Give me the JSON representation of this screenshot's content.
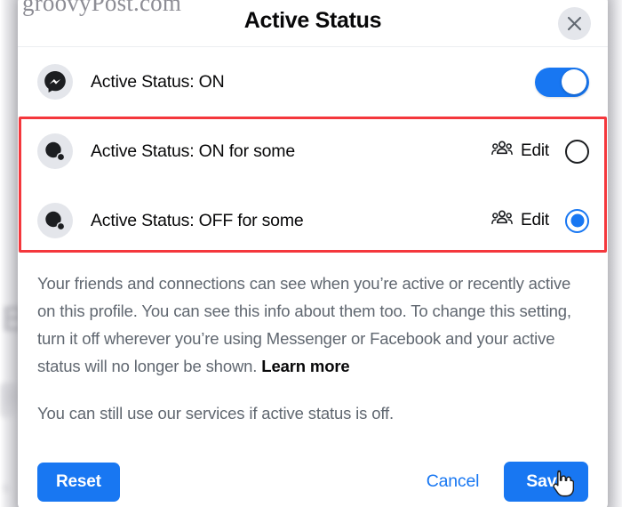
{
  "watermark": "groovyPost.com",
  "dialog": {
    "title": "Active Status",
    "close_icon": "close-icon",
    "accent_color": "#1877f2",
    "highlight_color": "#f4373c"
  },
  "options": [
    {
      "id": "active-status-on",
      "icon": "messenger-icon",
      "label": "Active Status: ON",
      "control": "toggle",
      "toggle_state": "on",
      "has_edit": false
    },
    {
      "id": "active-status-on-for-some",
      "icon": "friends-list-icon",
      "label": "Active Status: ON for some",
      "control": "radio",
      "selected": false,
      "has_edit": true,
      "edit_label": "Edit",
      "edit_icon": "people-group-icon"
    },
    {
      "id": "active-status-off-for-some",
      "icon": "friends-list-icon",
      "label": "Active Status: OFF for some",
      "control": "radio",
      "selected": true,
      "has_edit": true,
      "edit_label": "Edit",
      "edit_icon": "people-group-icon"
    }
  ],
  "body": {
    "paragraph_1_before_link": "Your friends and connections can see when you’re active or recently active on this profile. You can see this info about them too. To change this setting, turn it off wherever you’re using Messenger or Facebook and your active status will no longer be shown. ",
    "learn_more": "Learn more",
    "paragraph_2": "You can still use our services if active status is off."
  },
  "footer": {
    "reset_label": "Reset",
    "cancel_label": "Cancel",
    "save_label": "Save"
  },
  "cursor": {
    "type": "pointer-hand-cursor"
  }
}
